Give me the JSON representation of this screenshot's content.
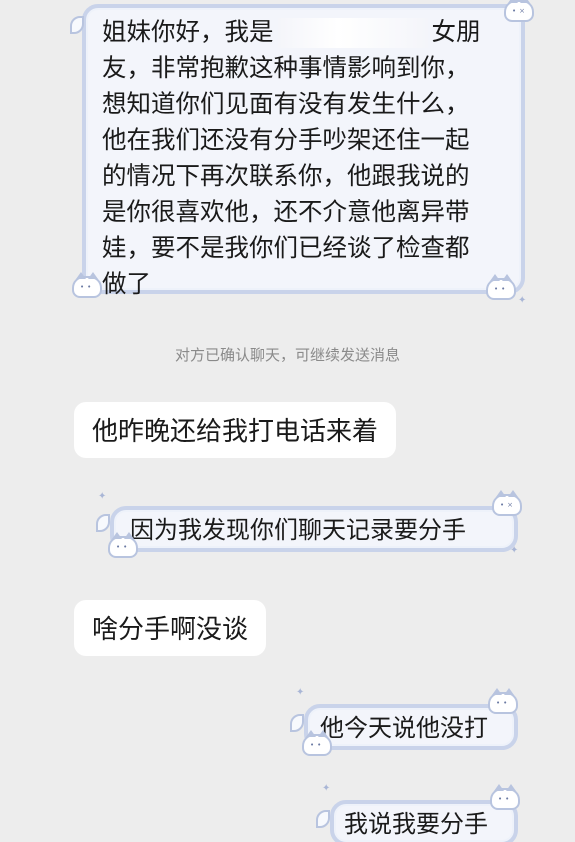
{
  "chat": {
    "first_message": {
      "line1_before": "姐妹你好，我是",
      "line1_after": "女朋",
      "lines": [
        "友，非常抱歉这种事情影响到你，",
        "想知道你们见面有没有发生什么，",
        "他在我们还没有分手吵架还住一起",
        "的情况下再次联系你，他跟我说的",
        "是你很喜欢他，还不介意他离异带",
        "娃，要不是我你们已经谈了检查都",
        "做了"
      ]
    },
    "system_notice": "对方已确认聊天，可继续发送消息",
    "messages": [
      {
        "side": "left",
        "text": "他昨晚还给我打电话来着"
      },
      {
        "side": "right",
        "text": "因为我发现你们聊天记录要分手"
      },
      {
        "side": "left",
        "text": "啥分手啊没谈"
      },
      {
        "side": "right",
        "text": "他今天说他没打"
      },
      {
        "side": "right",
        "text": "我说我要分手"
      }
    ]
  },
  "colors": {
    "background": "#ededed",
    "bubble_plain": "#ffffff",
    "bubble_deco_fill": "#f3f5fb",
    "bubble_deco_border": "#c9d3ea",
    "notice_text": "#8a8a8a"
  },
  "icons": [
    "cat-sticker-icon",
    "leaf-icon",
    "sparkle-icon"
  ]
}
